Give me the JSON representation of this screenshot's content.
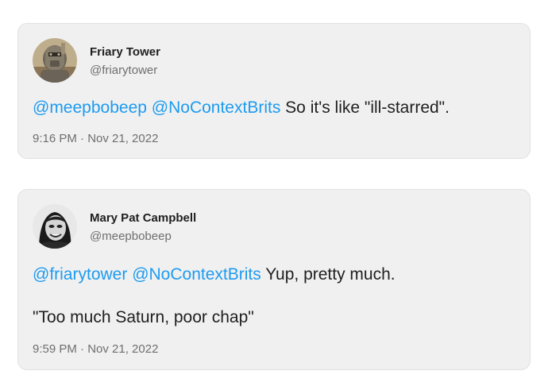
{
  "tweets": [
    {
      "display_name": "Friary Tower",
      "handle": "@friarytower",
      "avatar_icon": "robot-avatar-icon",
      "mentions": [
        "@meepbobeep",
        "@NoContextBrits"
      ],
      "text": "So it's like \"ill-starred\".",
      "timestamp": "9:16 PM · Nov 21, 2022"
    },
    {
      "display_name": "Mary Pat Campbell",
      "handle": "@meepbobeep",
      "avatar_icon": "person-avatar-icon",
      "mentions": [
        "@friarytower",
        "@NoContextBrits"
      ],
      "text": "Yup, pretty much.",
      "text_line_2": "\"Too much Saturn, poor chap\"",
      "timestamp": "9:59 PM · Nov 21, 2022"
    }
  ],
  "colors": {
    "mention": "#1d9bf0",
    "card_background": "#f0f0f0",
    "text": "#1f1f1f",
    "muted": "#6f6f6f"
  }
}
